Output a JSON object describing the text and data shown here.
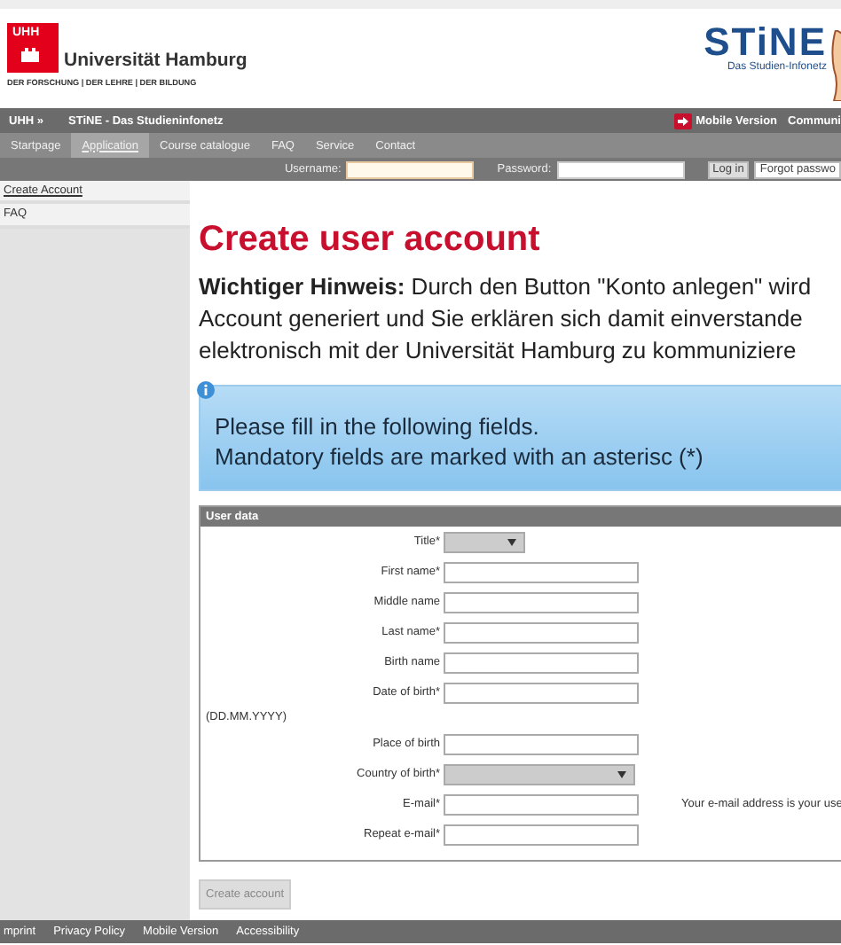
{
  "header": {
    "logo_text": "UHH",
    "university_name": "Universität Hamburg",
    "tagline": "DER FORSCHUNG | DER LEHRE | DER BILDUNG",
    "portal_name": "STiNE",
    "portal_subtitle": "Das Studien-Infonetz"
  },
  "top_bar": {
    "breadcrumbs": [
      "UHH »",
      "STiNE - Das Studieninfonetz"
    ],
    "links": [
      "Mobile Version",
      "Communi"
    ]
  },
  "nav_tabs": [
    {
      "label": "Startpage",
      "selected": false
    },
    {
      "label": "Application",
      "selected": true
    },
    {
      "label": "Course catalogue",
      "selected": false
    },
    {
      "label": "FAQ",
      "selected": false
    },
    {
      "label": "Service",
      "selected": false
    },
    {
      "label": "Contact",
      "selected": false
    }
  ],
  "login": {
    "username_label": "Username:",
    "password_label": "Password:",
    "login_button": "Log in",
    "forgot_button": "Forgot passwo"
  },
  "sidebar": {
    "items": [
      {
        "label": "Create Account",
        "selected": true
      },
      {
        "label": "FAQ",
        "selected": false
      }
    ]
  },
  "main": {
    "title": "Create user account",
    "notice_lines": [
      "**Wichtiger Hinweis:** Durch den Button \"Konto anlegen\" wird",
      "Account generiert und Sie erklären sich damit einverstande",
      "elektronisch mit der Universität Hamburg zu kommuniziere"
    ],
    "info_lines": [
      "Please fill in the following fields.",
      "Mandatory fields are marked with an asterisc (*)"
    ]
  },
  "form": {
    "legend": "User data",
    "fields": [
      {
        "label": "Title*",
        "kind": "select"
      },
      {
        "label": "First name*",
        "kind": "text"
      },
      {
        "label": "Middle name",
        "kind": "text"
      },
      {
        "label": "Last name*",
        "kind": "text"
      },
      {
        "label": "Birth name",
        "kind": "text"
      },
      {
        "label": "Date of birth*",
        "kind": "text",
        "hint": "(DD.MM.YYYY)"
      },
      {
        "label": "Place of birth",
        "kind": "text"
      },
      {
        "label": "Country of birth*",
        "kind": "wideselect"
      },
      {
        "label": "E-mail*",
        "kind": "text",
        "note": "Your e-mail address is your use"
      },
      {
        "label": "Repeat e-mail*",
        "kind": "text"
      }
    ],
    "submit_button": {
      "label": "Create account",
      "disabled": true
    }
  },
  "footer": {
    "links": [
      "mprint",
      "Privacy Policy",
      "Mobile Version",
      "Accessibility"
    ]
  }
}
